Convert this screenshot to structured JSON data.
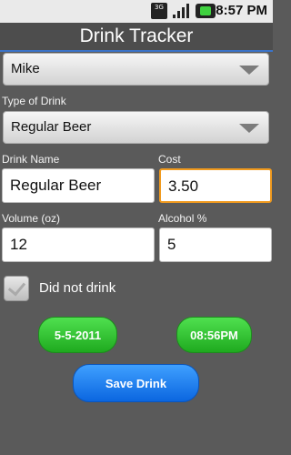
{
  "status": {
    "network_badge": "3G",
    "time": "8:57 PM",
    "icons": [
      "network-3g-icon",
      "signal-icon",
      "battery-icon"
    ]
  },
  "app": {
    "title": "Drink Tracker"
  },
  "person_select": {
    "value": "Mike"
  },
  "drink_type": {
    "label": "Type of Drink",
    "value": "Regular Beer"
  },
  "drink_name": {
    "label": "Drink Name",
    "value": "Regular Beer"
  },
  "cost": {
    "label": "Cost",
    "value": "3.50"
  },
  "volume": {
    "label": "Volume (oz)",
    "value": "12"
  },
  "alcohol": {
    "label": "Alcohol %",
    "value": "5"
  },
  "did_not_drink": {
    "label": "Did not drink",
    "checked": true
  },
  "buttons": {
    "date": "5-5-2011",
    "time": "08:56PM",
    "save": "Save Drink"
  },
  "colors": {
    "accent_line": "#3b73c8",
    "focus_border": "#f09a1e",
    "green_button": "#2fc42f",
    "blue_button": "#0b75f0"
  }
}
